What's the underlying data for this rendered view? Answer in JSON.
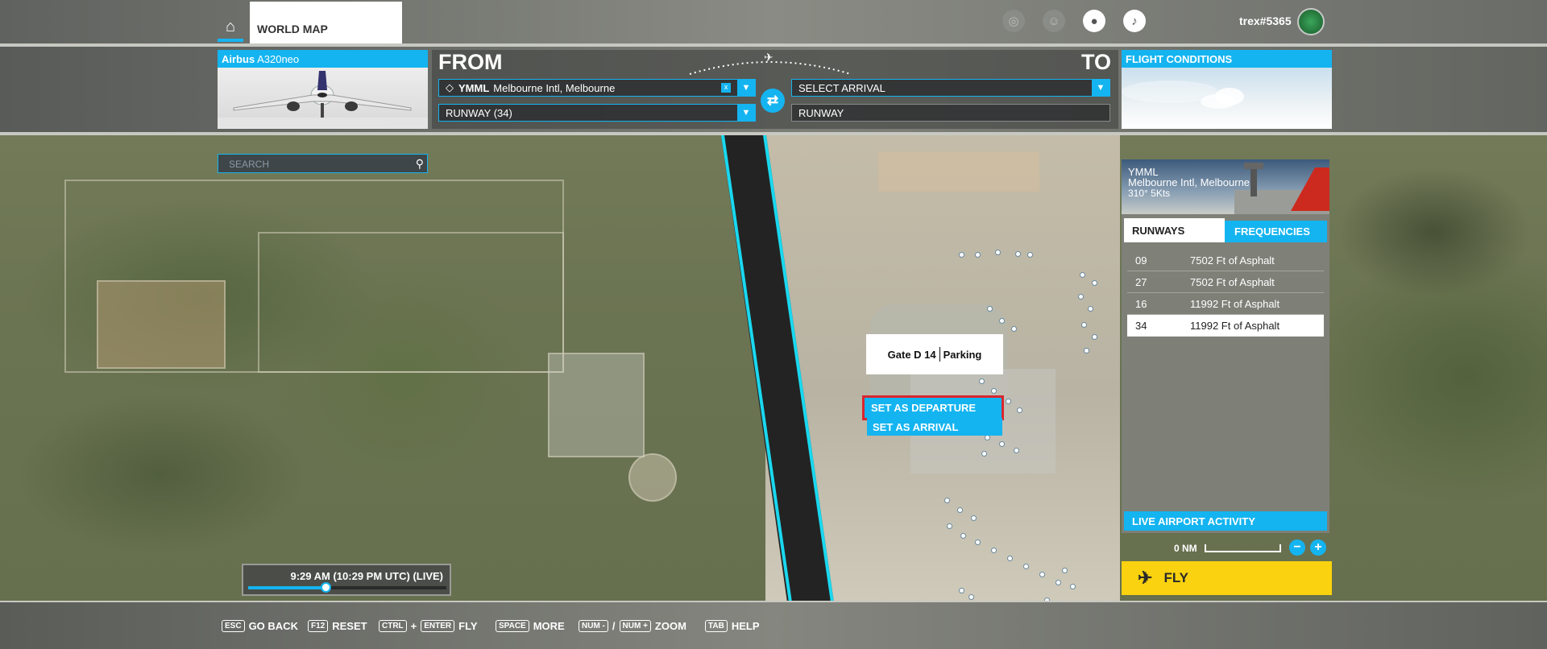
{
  "header": {
    "tab_label": "WORLD MAP",
    "username": "trex#5365"
  },
  "aircraft": {
    "make": "Airbus",
    "model": "A320neo"
  },
  "route": {
    "from_label": "FROM",
    "to_label": "TO",
    "departure_code": "YMML",
    "departure_name": "Melbourne Intl, Melbourne",
    "clear_label": "x",
    "departure_runway": "RUNWAY (34)",
    "arrival_placeholder": "SELECT ARRIVAL",
    "arrival_runway": "RUNWAY"
  },
  "conditions": {
    "label": "FLIGHT CONDITIONS"
  },
  "search": {
    "placeholder": "SEARCH"
  },
  "gate_popup": {
    "gate": "Gate D 14",
    "type": "Parking",
    "set_departure": "SET AS DEPARTURE",
    "set_arrival": "SET AS ARRIVAL"
  },
  "airport_info": {
    "code": "YMML",
    "name": "Melbourne Intl, Melbourne",
    "wind": "310° 5Kts",
    "tab_runways": "RUNWAYS",
    "tab_frequencies": "FREQUENCIES",
    "runways": [
      {
        "id": "09",
        "desc": "7502 Ft of Asphalt"
      },
      {
        "id": "27",
        "desc": "7502 Ft of Asphalt"
      },
      {
        "id": "16",
        "desc": "11992 Ft of Asphalt"
      },
      {
        "id": "34",
        "desc": "11992 Ft of Asphalt"
      }
    ],
    "live_activity": "LIVE AIRPORT ACTIVITY"
  },
  "zoom": {
    "scale_label": "0 NM",
    "minus": "−",
    "plus": "+"
  },
  "fly": {
    "label": "FLY"
  },
  "time": {
    "label": "9:29 AM (10:29 PM UTC) (LIVE)",
    "progress": 0.39
  },
  "help": {
    "esc_key": "ESC",
    "esc_label": "GO BACK",
    "f12_key": "F12",
    "f12_label": "RESET",
    "ctrl_key": "CTRL",
    "plus": "+",
    "enter_key": "ENTER",
    "fly_label": "FLY",
    "space_key": "SPACE",
    "more_label": "MORE",
    "num_minus_key": "NUM -",
    "slash": "/",
    "num_plus_key": "NUM +",
    "zoom_label": "ZOOM",
    "tab_key": "TAB",
    "help_label": "HELP"
  },
  "colors": {
    "accent": "#14b4f0",
    "fly": "#fad20f",
    "highlight": "#d9262e",
    "runway_edge": "#19d8ef"
  },
  "icons": {
    "home": "home-icon",
    "swap": "swap-icon",
    "search": "search-icon",
    "plane": "plane-icon"
  }
}
